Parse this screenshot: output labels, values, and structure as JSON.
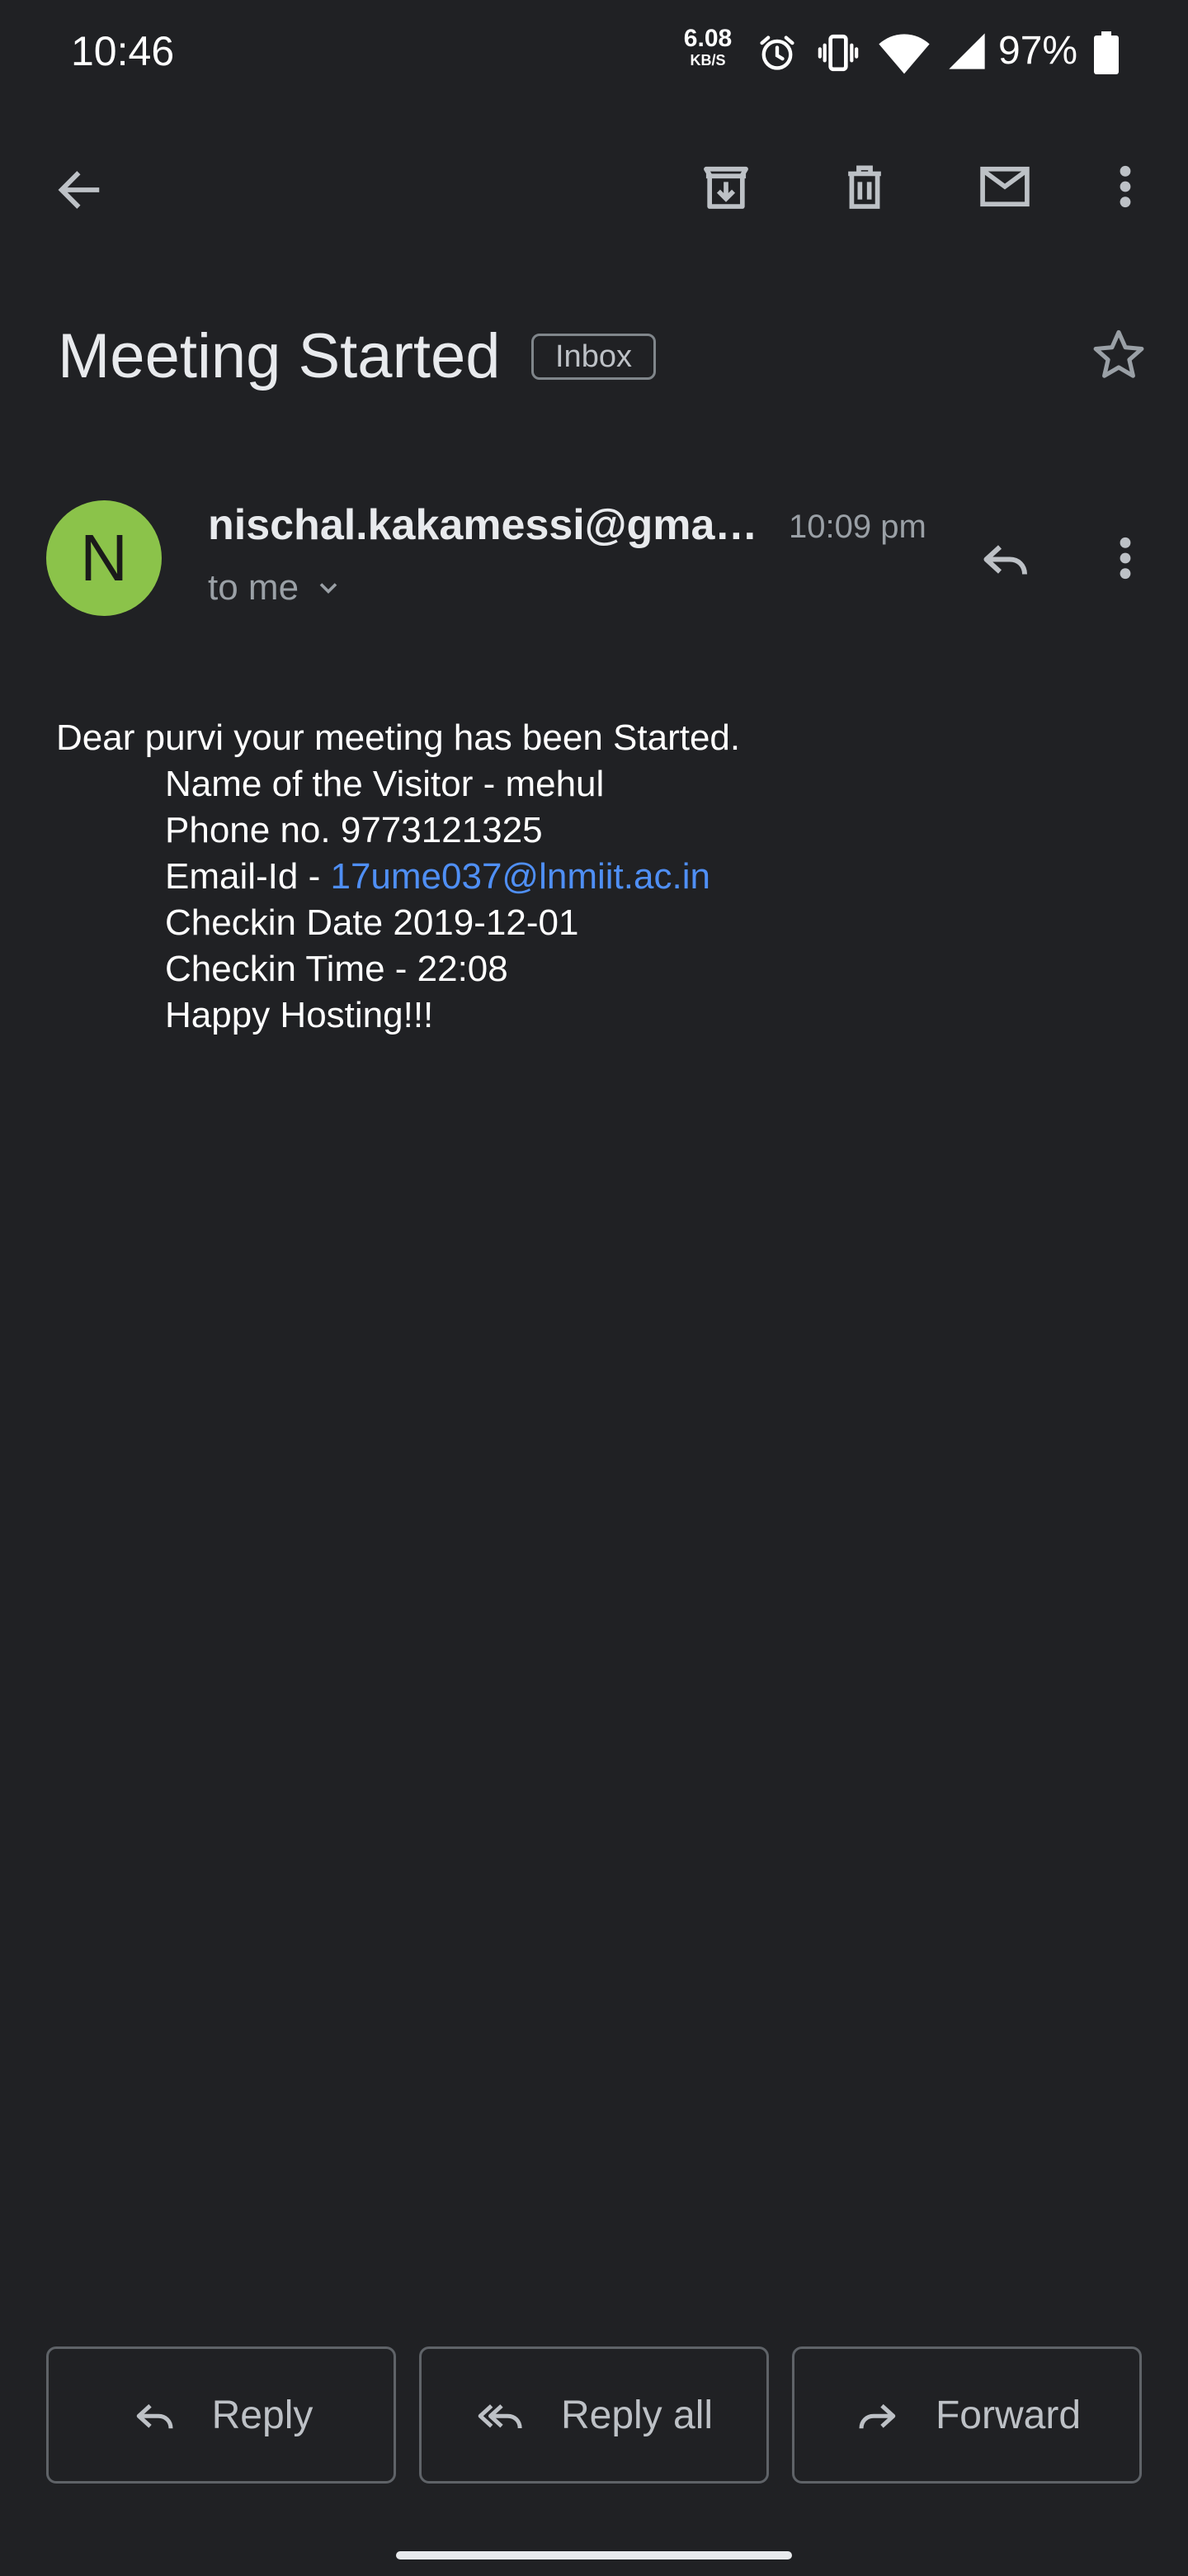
{
  "status_bar": {
    "time": "10:46",
    "net_speed_value": "6.08",
    "net_speed_unit": "KB/S",
    "battery": "97%",
    "icons": [
      "alarm-icon",
      "vibrate-icon",
      "wifi-icon",
      "signal-icon",
      "battery-icon"
    ]
  },
  "app_bar": {
    "icons": [
      "back-arrow-icon",
      "archive-icon",
      "delete-icon",
      "mark-unread-icon",
      "more-vert-icon"
    ]
  },
  "email": {
    "subject": "Meeting Started",
    "label": "Inbox",
    "sender": "nischal.kakamessi@gmail.com",
    "avatar_letter": "N",
    "avatar_color": "#8bc34a",
    "time": "10:09 pm",
    "recipients": "to me",
    "body": {
      "greeting": "Dear purvi your meeting has been Started.",
      "visitor": "Name of the Visitor - mehul",
      "phone": "Phone no. 9773121325",
      "email_prefix": "Email-Id - ",
      "email_link": "17ume037@lnmiit.ac.in",
      "checkin_date": "Checkin Date 2019-12-01",
      "checkin_time": "Checkin Time - 22:08",
      "closing": "Happy Hosting!!!"
    }
  },
  "actions": {
    "reply": "Reply",
    "reply_all": "Reply all",
    "forward": "Forward"
  },
  "colors": {
    "background": "#202124",
    "link": "#4f8ff5",
    "secondary_text": "#9aa0a6"
  }
}
